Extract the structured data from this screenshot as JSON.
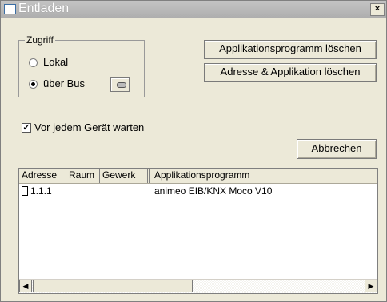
{
  "window": {
    "title": "Entladen",
    "close_glyph": "×"
  },
  "access_group": {
    "legend": "Zugriff",
    "options": [
      {
        "label": "Lokal",
        "checked": false
      },
      {
        "label": "über Bus",
        "checked": true
      }
    ]
  },
  "buttons": {
    "delete_app": "Applikationsprogramm löschen",
    "delete_addr_app": "Adresse & Applikation löschen",
    "cancel": "Abbrechen"
  },
  "wait_checkbox": {
    "label": "Vor jedem Gerät warten",
    "checked": true,
    "glyph": "✓"
  },
  "list": {
    "columns": [
      "Adresse",
      "Raum",
      "Gewerk",
      "Applikationsprogramm"
    ],
    "rows": [
      {
        "address": "1.1.1",
        "room": "",
        "trade": "",
        "application": "animeo EIB/KNX Moco V10"
      }
    ]
  },
  "scrollbar": {
    "left_glyph": "◀",
    "right_glyph": "▶"
  }
}
